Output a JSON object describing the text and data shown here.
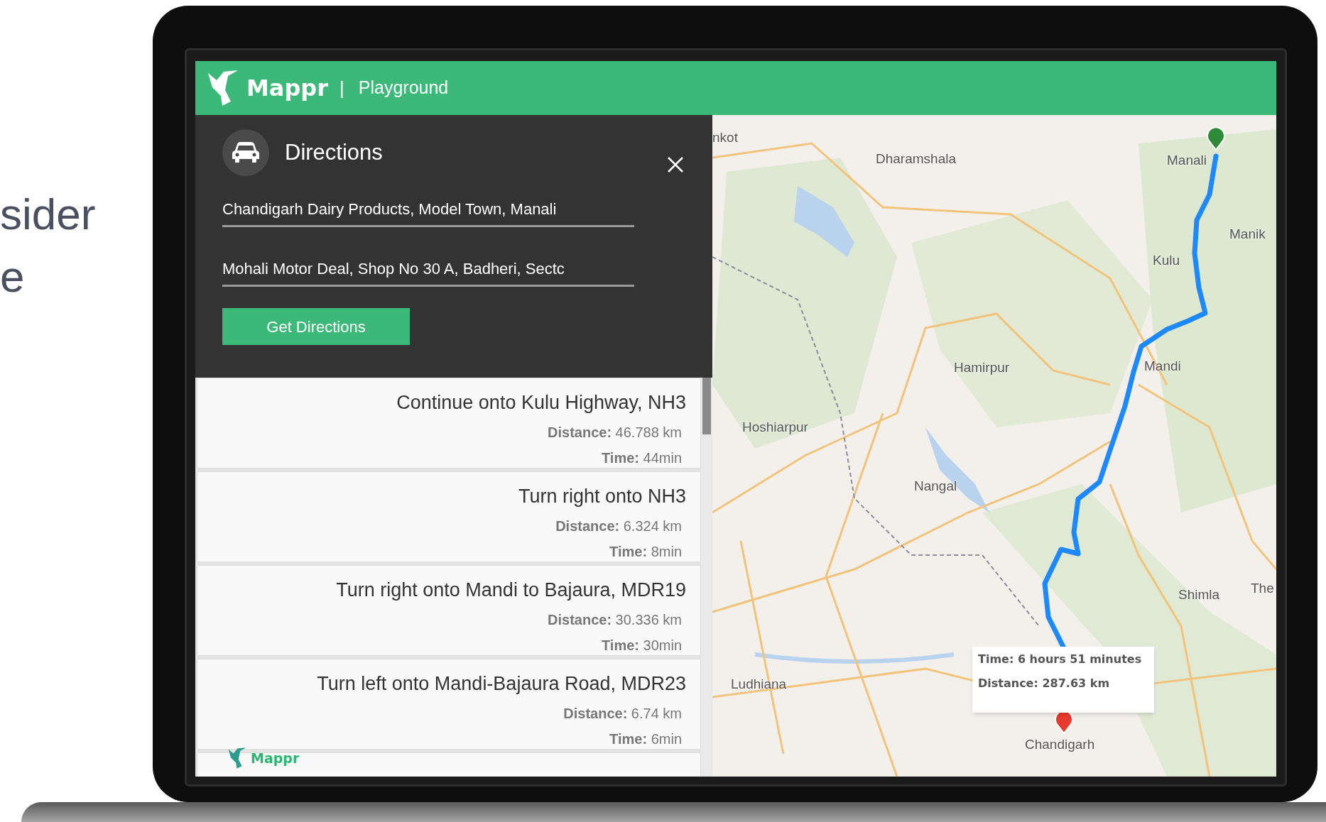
{
  "side_text": [
    "sider",
    "e"
  ],
  "app": {
    "brand": "Mappr",
    "separator": "|",
    "section": "Playground"
  },
  "directions_panel": {
    "title": "Directions",
    "origin": {
      "value": "Chandigarh Dairy Products, Model Town, Manali"
    },
    "destination": {
      "value": "Mohali Motor Deal, Shop No 30 A, Badheri, Sectc"
    },
    "button": "Get Directions"
  },
  "steps": [
    {
      "instruction": "Continue onto Kulu Highway, NH3",
      "distance": "**Distance:** 46.788 km",
      "time": "**Time:** 44min"
    },
    {
      "instruction": "Turn right onto NH3",
      "distance": "**Distance:** 6.324 km",
      "time": "**Time:** 8min"
    },
    {
      "instruction": "Turn right onto Mandi to Bajaura, MDR19",
      "distance": "**Distance:** 30.336 km",
      "time": "**Time:** 30min"
    },
    {
      "instruction": "Turn left onto Mandi-Bajaura Road, MDR23",
      "distance": "**Distance:** 6.74 km",
      "time": "**Time:** 6min"
    }
  ],
  "footer_logo": "Mappr",
  "map": {
    "labels": [
      "nkot",
      "Dharamshala",
      "Manali",
      "Manik",
      "Kulu",
      "Mandi",
      "Hamirpur",
      "Hoshiarpur",
      "Nangal",
      "Shimla",
      "The",
      "Ludhiana",
      "Chandigarh"
    ],
    "summary": {
      "time": "Time: 6 hours 51 minutes",
      "distance": "Distance: 287.63 km"
    }
  }
}
